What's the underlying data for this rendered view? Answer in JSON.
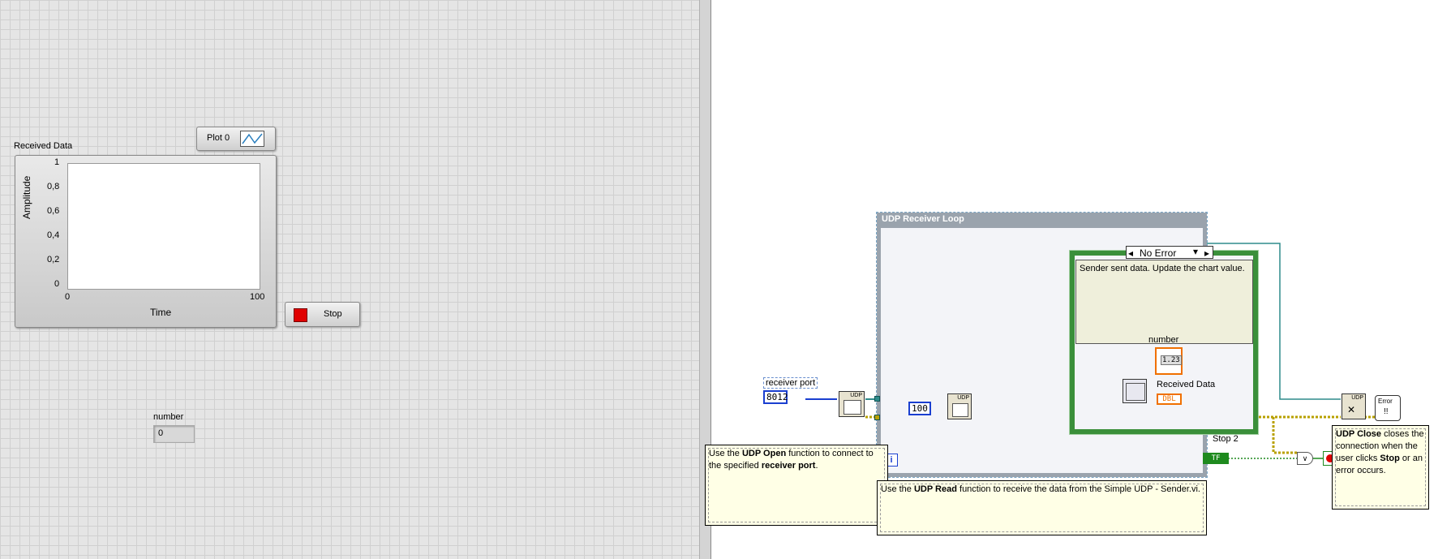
{
  "front_panel": {
    "chart": {
      "label": "Received Data",
      "y_axis_label": "Amplitude",
      "x_axis_label": "Time",
      "y_ticks": [
        "1",
        "0,8",
        "0,6",
        "0,4",
        "0,2",
        "0"
      ],
      "x_ticks": [
        "0",
        "100"
      ],
      "legend_label": "Plot 0"
    },
    "stop_button_label": "Stop",
    "number_label": "number",
    "number_value": "0"
  },
  "block_diagram": {
    "loop_title": "UDP Receiver Loop",
    "case_selector": "No Error",
    "case_comment": "Sender sent data. Update the chart value.",
    "number_indicator_label": "number",
    "number_indicator_glyph": "1.23",
    "received_data_label": "Received Data",
    "received_data_glyph": "DBL",
    "receiver_port_label": "receiver port",
    "receiver_port_value": "8012",
    "timeout_value": "100",
    "stop2_label": "Stop 2",
    "stop2_glyph": "TF",
    "iteration_glyph": "i",
    "udp_node_label": "UDP",
    "error_node_label": "Error",
    "comment_open": {
      "prefix": "Use the ",
      "bold1": "UDP Open",
      "mid": " function to connect to the specified ",
      "bold2": "receiver port",
      "suffix": "."
    },
    "comment_read": {
      "prefix": "Use the ",
      "bold1": "UDP Read",
      "suffix": " function to receive the data from the Simple UDP - Sender.vi."
    },
    "comment_close": {
      "bold1": "UDP Close",
      "mid": " closes the connection when the user clicks ",
      "bold2": "Stop",
      "suffix": " or an error occurs."
    }
  },
  "colors": {
    "wire_error": "#b8a000",
    "wire_refnum": "#2e8b8b",
    "wire_string": "#e040e0",
    "wire_double": "#f07000",
    "wire_int": "#1a3fd0",
    "wire_bool": "#1e8a1e"
  }
}
